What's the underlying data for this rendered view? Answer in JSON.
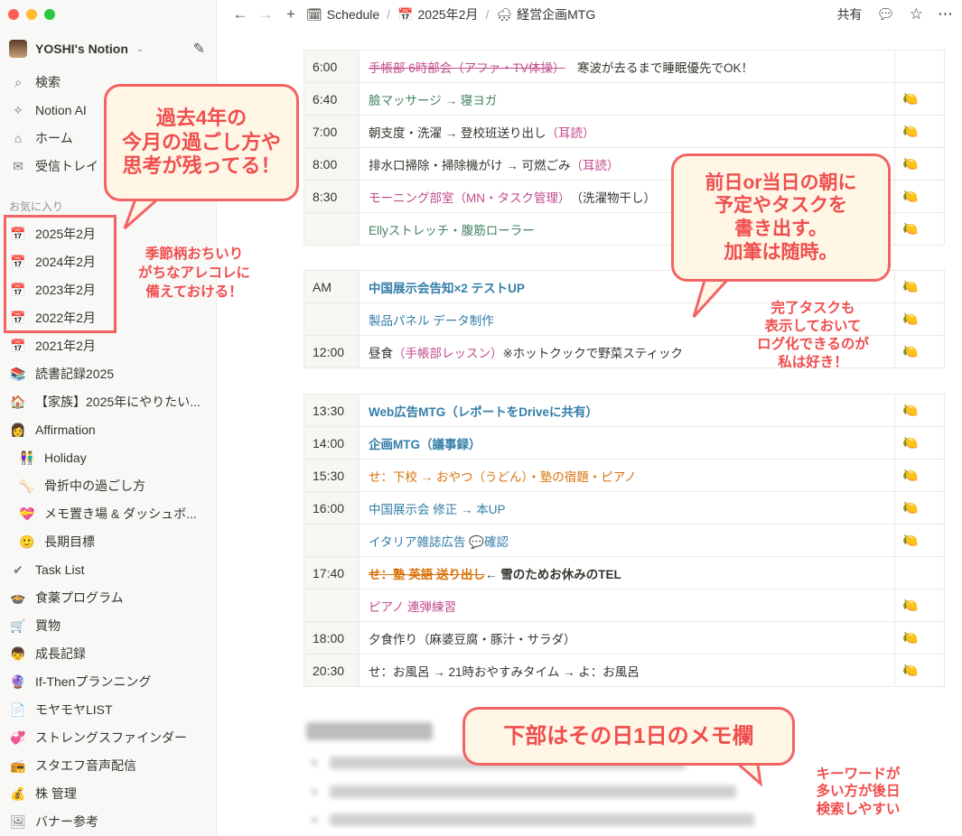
{
  "colors": {
    "pink": "#c14c8a",
    "green": "#448361",
    "blue": "#337ea9",
    "orange": "#d9730d",
    "text": "#37352f",
    "callout": "#f04e4e"
  },
  "sidebar": {
    "workspace": "YOSHI's Notion",
    "nav": [
      {
        "icon": "search-icon",
        "glyph": "⌕",
        "label": "検索"
      },
      {
        "icon": "notion-ai-icon",
        "glyph": "✧",
        "label": "Notion AI"
      },
      {
        "icon": "home-icon",
        "glyph": "⌂",
        "label": "ホーム"
      },
      {
        "icon": "inbox-icon",
        "glyph": "✉",
        "label": "受信トレイ"
      }
    ],
    "section": "お気に入り",
    "items": [
      {
        "glyph": "📅",
        "label": "2025年2月"
      },
      {
        "glyph": "📅",
        "label": "2024年2月"
      },
      {
        "glyph": "📅",
        "label": "2023年2月"
      },
      {
        "glyph": "📅",
        "label": "2022年2月"
      },
      {
        "glyph": "📅",
        "label": "2021年2月"
      },
      {
        "glyph": "📚",
        "label": "読書記録2025"
      },
      {
        "glyph": "🏠",
        "label": "【家族】2025年にやりたい..."
      },
      {
        "glyph": "👩",
        "label": "Affirmation"
      },
      {
        "glyph": "👫",
        "label": "Holiday",
        "indent": true
      },
      {
        "glyph": "🦴",
        "label": "骨折中の過ごし方",
        "indent": true
      },
      {
        "glyph": "💝",
        "label": "メモ置き場 & ダッシュボ...",
        "indent": true
      },
      {
        "glyph": "🙂",
        "label": "長期目標",
        "indent": true
      },
      {
        "glyph": "✔",
        "label": "Task List"
      },
      {
        "glyph": "🍲",
        "label": "食薬プログラム"
      },
      {
        "glyph": "🛒",
        "label": "買物"
      },
      {
        "glyph": "👦",
        "label": "成長記録"
      },
      {
        "glyph": "🔮",
        "label": "If-Thenプランニング"
      },
      {
        "glyph": "📄",
        "label": "モヤモヤLIST"
      },
      {
        "glyph": "💞",
        "label": "ストレングスファインダー"
      },
      {
        "glyph": "📻",
        "label": "スタエフ音声配信"
      },
      {
        "glyph": "💰",
        "label": "株 管理"
      },
      {
        "glyph": "🖼",
        "label": "バナー参考"
      }
    ]
  },
  "topbar": {
    "breadcrumb": [
      {
        "glyph": "🗓",
        "label": "Schedule"
      },
      {
        "glyph": "📅",
        "label": "2025年2月"
      },
      {
        "glyph": "🌨",
        "label": "経営企画MTG"
      }
    ],
    "share": "共有"
  },
  "tables": [
    [
      {
        "time": "6:00",
        "segs": [
          {
            "t": "手帳部 6時部会（アファ・TV体操）",
            "c": "pink",
            "s": true
          },
          {
            "t": "　寒波が去るまで睡眠優先でOK！"
          }
        ],
        "lemon": false
      },
      {
        "time": "6:40",
        "segs": [
          {
            "t": "臉マッサージ → 寝ヨガ",
            "c": "green"
          }
        ],
        "lemon": true
      },
      {
        "time": "7:00",
        "segs": [
          {
            "t": "朝支度・洗濯 → 登校班送り出し"
          },
          {
            "t": "（耳読）",
            "c": "pink"
          }
        ],
        "lemon": true
      },
      {
        "time": "8:00",
        "segs": [
          {
            "t": "排水口掃除・掃除機がけ → 可燃ごみ"
          },
          {
            "t": "（耳読）",
            "c": "pink"
          }
        ],
        "lemon": true
      },
      {
        "time": "8:30",
        "segs": [
          {
            "t": "モーニング部室（MN・タスク管理）",
            "c": "pink"
          },
          {
            "t": "（洗濯物干し）"
          }
        ],
        "lemon": true
      },
      {
        "time": "",
        "segs": [
          {
            "t": "Ellyストレッチ・腹筋ローラー",
            "c": "green"
          }
        ],
        "lemon": true
      }
    ],
    [
      {
        "time": "AM",
        "segs": [
          {
            "t": "中国展示会告知×2 テストUP",
            "c": "blue",
            "b": true
          }
        ],
        "lemon": true
      },
      {
        "time": "",
        "segs": [
          {
            "t": "製品パネル データ制作",
            "c": "blue"
          }
        ],
        "lemon": true
      },
      {
        "time": "12:00",
        "segs": [
          {
            "t": "昼食"
          },
          {
            "t": "（手帳部レッスン）",
            "c": "pink"
          },
          {
            "t": "※ホットクックで野菜スティック"
          }
        ],
        "lemon": true
      }
    ],
    [
      {
        "time": "13:30",
        "segs": [
          {
            "t": "Web広告MTG（レポートをDriveに共有）",
            "c": "blue",
            "b": true
          }
        ],
        "lemon": true
      },
      {
        "time": "14:00",
        "segs": [
          {
            "t": "企画MTG（議事録）",
            "c": "blue",
            "b": true
          }
        ],
        "lemon": true
      },
      {
        "time": "15:30",
        "segs": [
          {
            "t": "せ：下校 → おやつ（うどん）・塾の宿題・ピアノ",
            "c": "orange"
          }
        ],
        "lemon": true
      },
      {
        "time": "16:00",
        "segs": [
          {
            "t": "中国展示会 修正 → 本UP",
            "c": "blue"
          }
        ],
        "lemon": true
      },
      {
        "time": "",
        "segs": [
          {
            "t": "イタリア雑誌広告 💬確認",
            "c": "blue"
          }
        ],
        "lemon": true
      },
      {
        "time": "17:40",
        "segs": [
          {
            "t": "せ：塾 英語 送り出し",
            "c": "orange",
            "s": true,
            "b": true
          },
          {
            "t": " ← 雪のためお休みのTEL",
            "b": true
          }
        ],
        "lemon": false
      },
      {
        "time": "",
        "segs": [
          {
            "t": "ピアノ 連弾練習",
            "c": "pink"
          }
        ],
        "lemon": true
      },
      {
        "time": "18:00",
        "segs": [
          {
            "t": "夕食作り（麻婆豆腐・豚汁・サラダ）"
          }
        ],
        "lemon": true
      },
      {
        "time": "20:30",
        "segs": [
          {
            "t": "せ：お風呂 → 21時おやすみタイム → よ：お風呂"
          }
        ],
        "lemon": true
      }
    ]
  ],
  "lemon_glyph": "🍋",
  "callouts": {
    "past": [
      "過去4年の",
      "今月の過ごし方や",
      "思考が残ってる！"
    ],
    "season": [
      "季節柄おちいり",
      "がちなアレコレに",
      "備えておける！"
    ],
    "plan": [
      "前日or当日の朝に",
      "予定やタスクを",
      "書き出す。",
      "加筆は随時。"
    ],
    "done": [
      "完了タスクも",
      "表示しておいて",
      "ログ化できるのが",
      "私は好き！"
    ],
    "memo": [
      "下部はその日1日のメモ欄"
    ],
    "keyword": [
      "キーワードが",
      "多い方が後日",
      "検索しやすい"
    ]
  }
}
